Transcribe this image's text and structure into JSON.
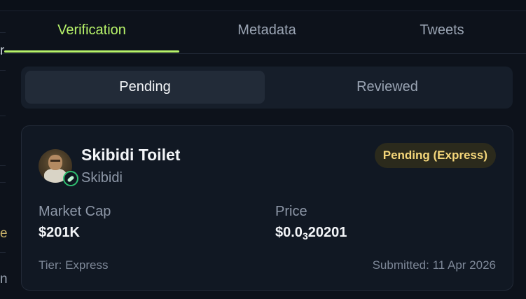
{
  "tabs": [
    {
      "label": "Verification",
      "active": true
    },
    {
      "label": "Metadata",
      "active": false
    },
    {
      "label": "Tweets",
      "active": false
    }
  ],
  "segments": {
    "pending_label": "Pending",
    "reviewed_label": "Reviewed",
    "selected": "Pending"
  },
  "card": {
    "name": "Skibidi Toilet",
    "symbol": "Skibidi",
    "status": "Pending (Express)",
    "market_cap_label": "Market Cap",
    "market_cap_value": "$201K",
    "price_label": "Price",
    "price_prefix": "$0.0",
    "price_zero_count": "3",
    "price_digits": "20201",
    "tier": "Tier: Express",
    "submitted": "Submitted: 11 Apr 2026"
  },
  "left_edge": {
    "chars": [
      "r",
      "e",
      "n"
    ]
  },
  "colors": {
    "accent": "#b7f36a",
    "status_text": "#f4d67a",
    "status_bg": "#2b2a1c",
    "verified_ring": "#2fbf71",
    "background": "#0d121b"
  },
  "icons": [
    "token-avatar",
    "verified-badge-icon"
  ]
}
